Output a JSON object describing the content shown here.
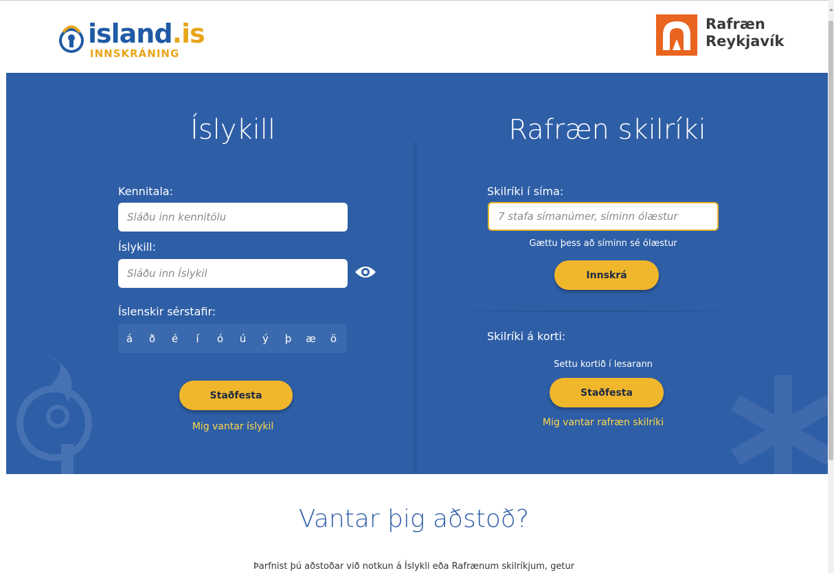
{
  "header": {
    "left_logo_main": "island",
    "left_logo_is": ".is",
    "left_logo_sub": "INNSKRÁNING",
    "right_logo_line1": "Rafræn",
    "right_logo_line2": "Reykjavík"
  },
  "islykill": {
    "title": "Íslykill",
    "kennitala_label": "Kennitala:",
    "kennitala_placeholder": "Sláðu inn kennitölu",
    "islykill_label": "Íslykill:",
    "islykill_placeholder": "Sláðu inn Íslykil",
    "special_chars_label": "Íslenskir sérstafir:",
    "special_chars": [
      "á",
      "ð",
      "é",
      "í",
      "ó",
      "ú",
      "ý",
      "þ",
      "æ",
      "ö"
    ],
    "submit_label": "Staðfesta",
    "need_link": "Mig vantar íslykil"
  },
  "rafraen": {
    "title": "Rafræn skilríki",
    "phone_label": "Skilríki í síma:",
    "phone_placeholder": "7 stafa símanúmer, síminn ólæstur",
    "phone_note": "Gættu þess að síminn sé ólæstur",
    "login_label": "Innskrá",
    "card_label": "Skilríki á korti:",
    "card_note": "Settu kortið í lesarann",
    "card_submit_label": "Staðfesta",
    "need_link": "Mig vantar rafræn skilríki"
  },
  "help": {
    "title": "Vantar þig aðstoð?",
    "text": "Þarfnist þú aðstoðar við notkun á Íslykli eða Rafrænum skilríkjum, getur"
  },
  "colors": {
    "panel": "#2e5ea6",
    "accent": "#f0b62c",
    "link": "#ffd84a",
    "brand_orange": "#e8641f"
  }
}
